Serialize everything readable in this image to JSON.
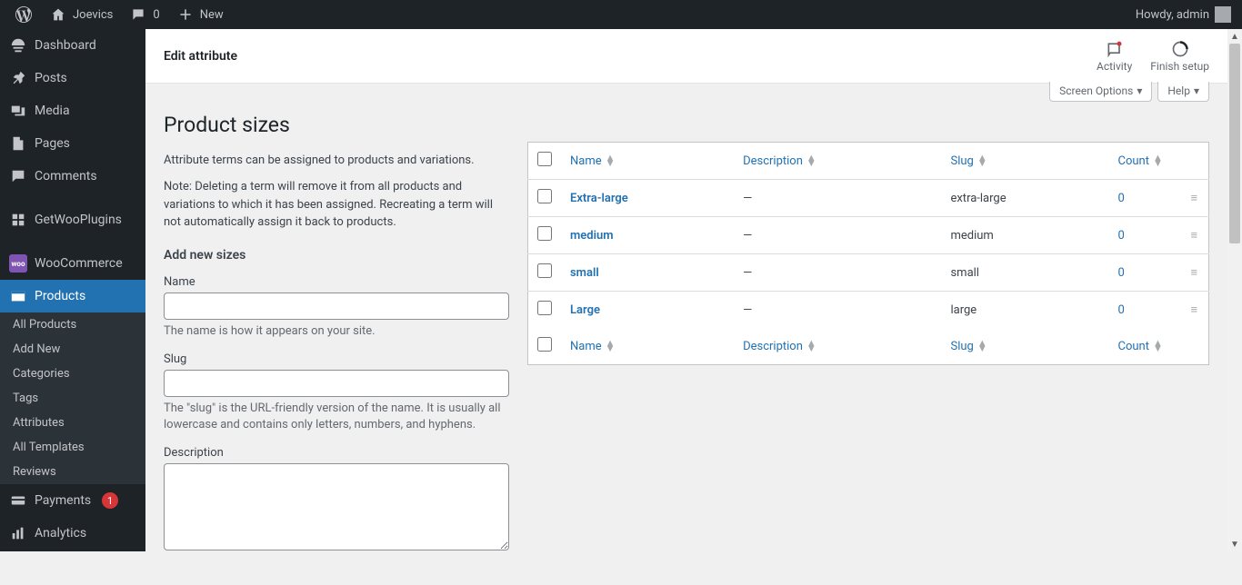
{
  "adminbar": {
    "site_name": "Joevics",
    "comments_count": "0",
    "new_label": "New",
    "howdy": "Howdy, admin"
  },
  "sidebar": {
    "items": [
      {
        "label": "Dashboard",
        "icon": "dashboard"
      },
      {
        "label": "Posts",
        "icon": "pin"
      },
      {
        "label": "Media",
        "icon": "media"
      },
      {
        "label": "Pages",
        "icon": "pages"
      },
      {
        "label": "Comments",
        "icon": "comment"
      },
      {
        "label": "GetWooPlugins",
        "icon": "plugin"
      },
      {
        "label": "WooCommerce",
        "icon": "woo"
      },
      {
        "label": "Products",
        "icon": "products",
        "current": true
      },
      {
        "label": "Payments",
        "icon": "payments",
        "badge": "1"
      },
      {
        "label": "Analytics",
        "icon": "analytics"
      }
    ],
    "submenu": [
      {
        "label": "All Products"
      },
      {
        "label": "Add New"
      },
      {
        "label": "Categories"
      },
      {
        "label": "Tags"
      },
      {
        "label": "Attributes"
      },
      {
        "label": "All Templates"
      },
      {
        "label": "Reviews"
      }
    ]
  },
  "header": {
    "title": "Edit attribute",
    "activity": "Activity",
    "finish_setup": "Finish setup"
  },
  "screen_meta": {
    "screen_options": "Screen Options",
    "help": "Help"
  },
  "page": {
    "heading": "Product sizes",
    "description": "Attribute terms can be assigned to products and variations.",
    "note": "Note: Deleting a term will remove it from all products and variations to which it has been assigned. Recreating a term will not automatically assign it back to products.",
    "add_heading": "Add new sizes"
  },
  "form": {
    "name_label": "Name",
    "name_hint": "The name is how it appears on your site.",
    "slug_label": "Slug",
    "slug_hint": "The \"slug\" is the URL-friendly version of the name. It is usually all lowercase and contains only letters, numbers, and hyphens.",
    "description_label": "Description"
  },
  "table": {
    "columns": {
      "name": "Name",
      "description": "Description",
      "slug": "Slug",
      "count": "Count"
    },
    "rows": [
      {
        "name": "Extra-large",
        "description": "—",
        "slug": "extra-large",
        "count": "0"
      },
      {
        "name": "medium",
        "description": "—",
        "slug": "medium",
        "count": "0"
      },
      {
        "name": "small",
        "description": "—",
        "slug": "small",
        "count": "0"
      },
      {
        "name": "Large",
        "description": "—",
        "slug": "large",
        "count": "0"
      }
    ]
  }
}
